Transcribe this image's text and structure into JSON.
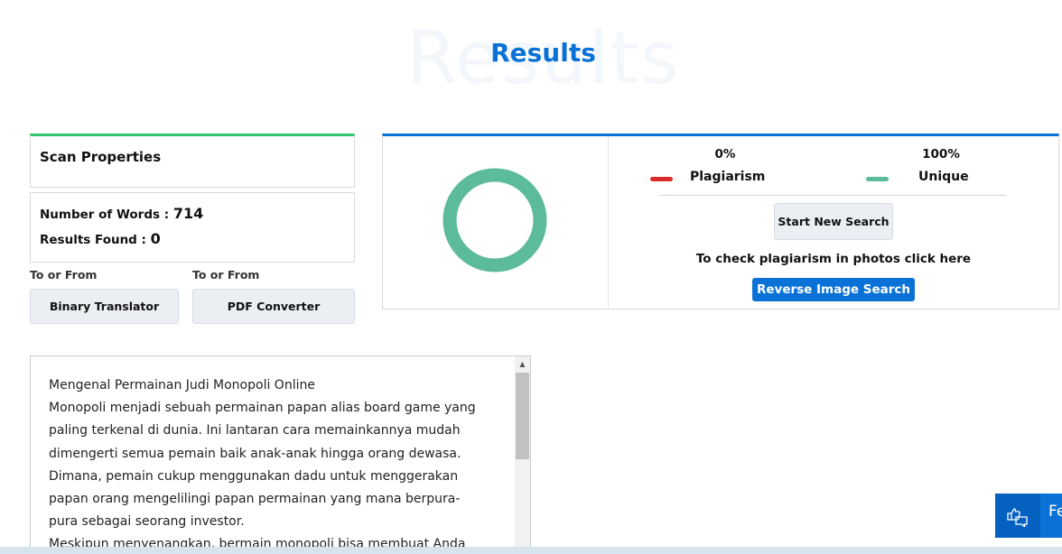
{
  "header": {
    "ghost": "Results",
    "title": "Results"
  },
  "scan": {
    "title": "Scan Properties",
    "words_label": "Number of Words :",
    "words": "714",
    "results_label": "Results Found :",
    "results": "0"
  },
  "tools": [
    {
      "caption": "To or From",
      "label": "Binary Translator"
    },
    {
      "caption": "To or From",
      "label": "PDF Converter"
    }
  ],
  "result": {
    "plagiarism_pct": "0%",
    "plagiarism_label": "Plagiarism",
    "unique_pct": "100%",
    "unique_label": "Unique",
    "plagiarism_value": 0,
    "unique_value": 100,
    "colors": {
      "plagiarism": "#d92b2b",
      "unique": "#5bbb9a",
      "accent": "#0a72d6"
    },
    "start_new": "Start New Search",
    "photo_note": "To check plagiarism in photos click here",
    "reverse": "Reverse Image Search"
  },
  "text_lines": [
    "Mengenal Permainan Judi Monopoli Online",
    "Monopoli menjadi sebuah permainan papan alias board game yang",
    "paling terkenal di dunia. Ini lantaran cara memainkannya mudah",
    "dimengerti semua pemain baik anak-anak hingga orang dewasa.",
    "Dimana, pemain cukup menggunakan dadu untuk menggerakan",
    "papan orang mengelilingi papan permainan yang mana berpura-",
    "pura sebagai seorang investor.",
    "Meskipun menyenangkan, bermain monopoli bisa membuat Anda"
  ],
  "feedback": {
    "label": "Fe",
    "icon": "feedback-thumbs-up-icon"
  }
}
